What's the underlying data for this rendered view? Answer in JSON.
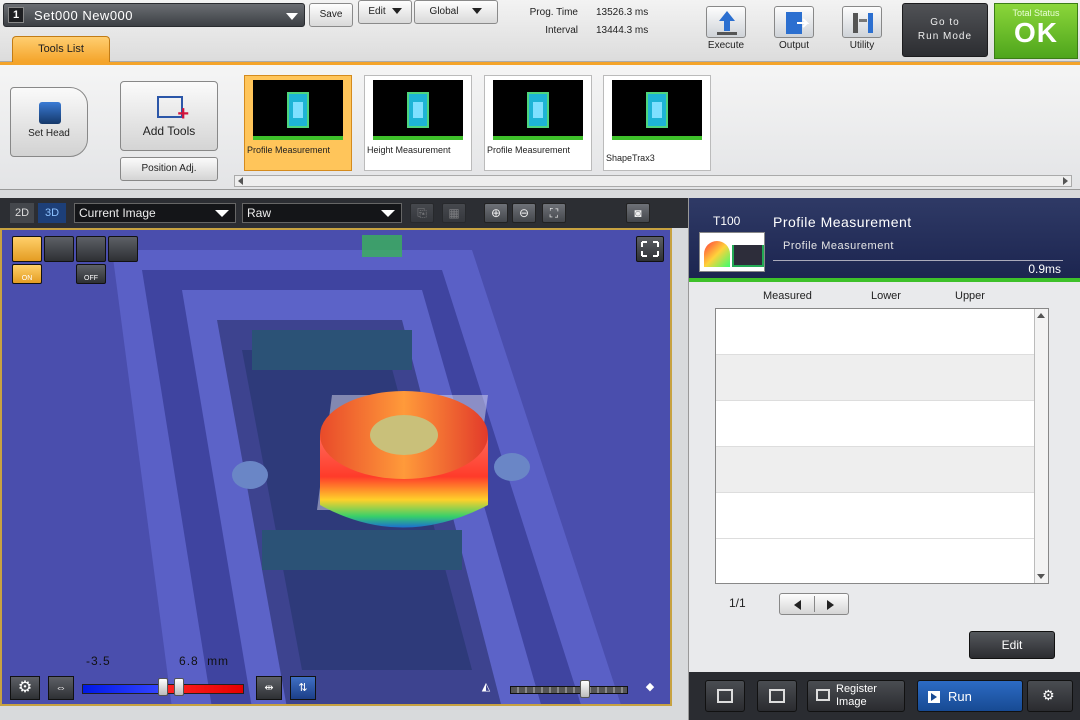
{
  "topbar": {
    "set_number": "1",
    "set_title": "Set000  New000",
    "save_label": "Save",
    "edit_label": "Edit",
    "scope_label": "Global",
    "prog_time_label": "Prog. Time",
    "prog_time_value": "13526.3 ms",
    "interval_label": "Interval",
    "interval_value": "13444.3 ms",
    "execute_label": "Execute",
    "output_label": "Output",
    "utility_label": "Utility",
    "run_mode_label_1": "Go to",
    "run_mode_label_2": "Run Mode",
    "status_label": "Total Status",
    "status_value": "OK",
    "status_color": "#5cb82a"
  },
  "tools": {
    "tab_label": "Tools List",
    "set_head_label": "Set Head",
    "add_tools_label": "Add Tools",
    "position_adj_label": "Position Adj.",
    "items": [
      {
        "label": "Profile Measurement",
        "selected": true
      },
      {
        "label": "Height Measurement",
        "selected": false
      },
      {
        "label": "Profile Measurement",
        "selected": false
      },
      {
        "label": "ShapeTrax3",
        "selected": false
      }
    ]
  },
  "viewer": {
    "mode_2d": "2D",
    "mode_3d": "3D",
    "image_select": "Current Image",
    "display_select": "Raw",
    "overlay_on": "ON",
    "overlay_off": "OFF",
    "range_min": "-3.5",
    "range_max": "6.8",
    "range_unit": "mm",
    "accent_color": "#c7a241"
  },
  "result": {
    "tool_id": "T100",
    "tool_name": "Profile Measurement",
    "tool_subname": "Profile Measurement",
    "exec_time": "0.9ms",
    "col_measured": "Measured",
    "col_lower": "Lower",
    "col_upper": "Upper",
    "page": "1/1",
    "edit_label": "Edit",
    "register_image_label_1": "Register",
    "register_image_label_2": "Image",
    "run_label": "Run"
  }
}
